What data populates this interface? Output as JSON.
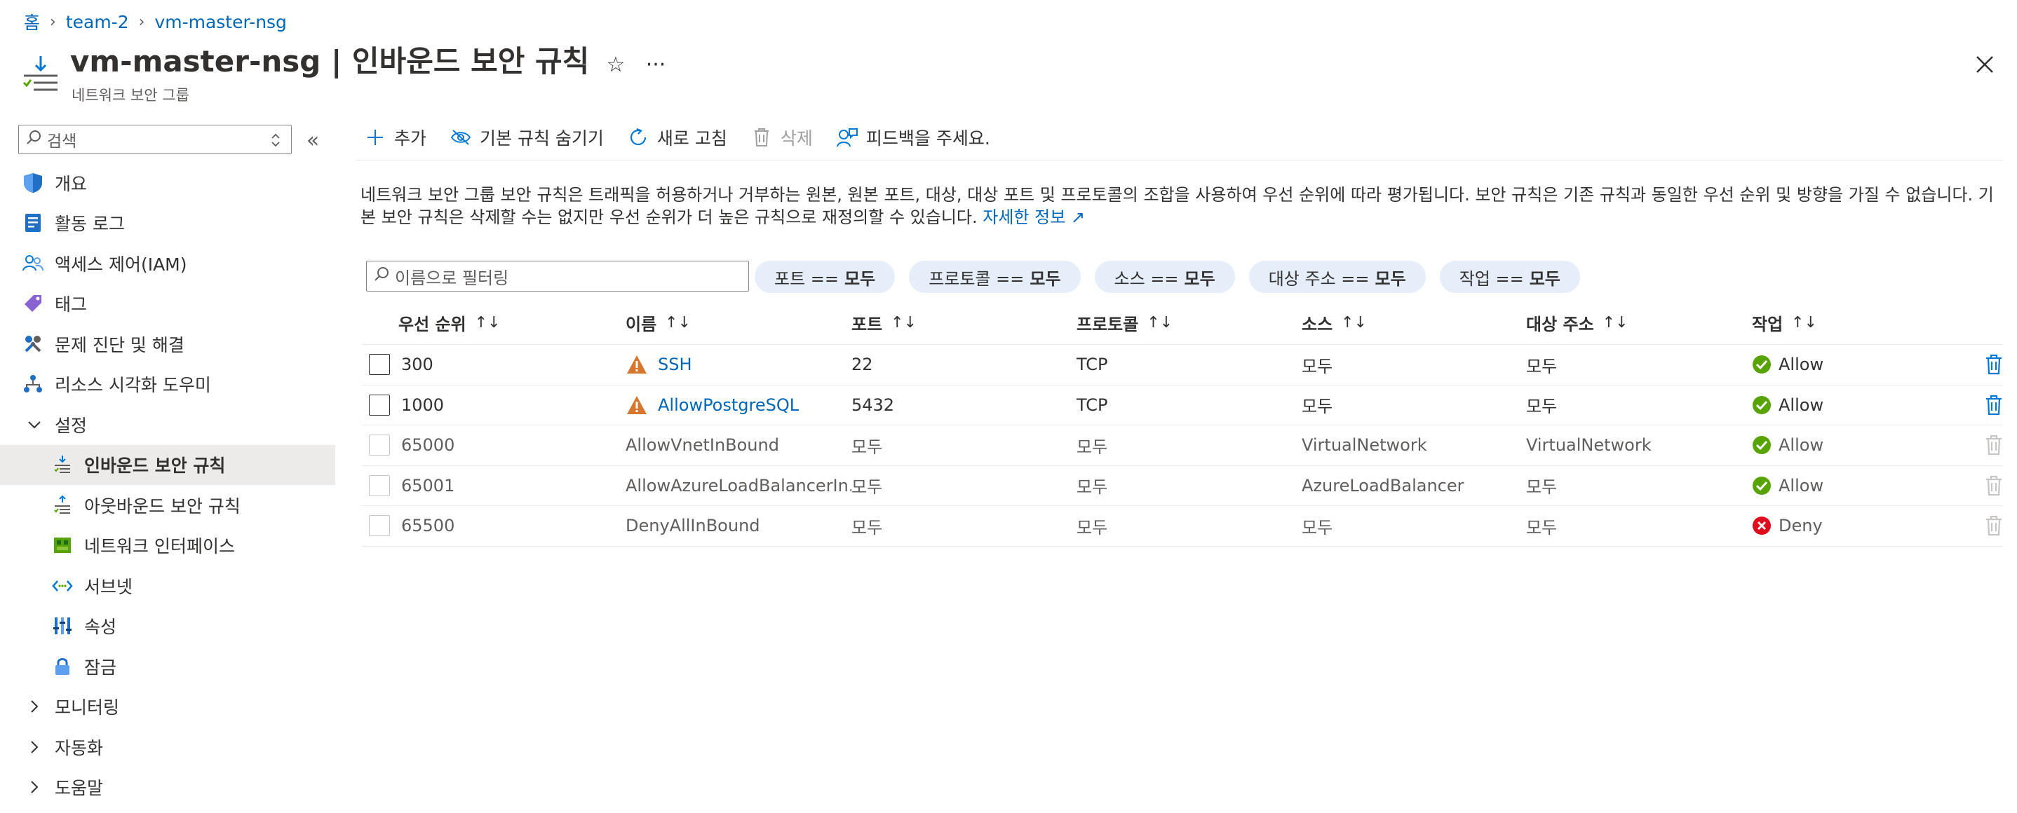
{
  "breadcrumb": [
    "홈",
    "team-2",
    "vm-master-nsg"
  ],
  "header": {
    "title": "vm-master-nsg | 인바운드 보안 규칙",
    "subtitle": "네트워크 보안 그룹"
  },
  "sidebar": {
    "search_placeholder": "검색",
    "items": [
      {
        "label": "개요",
        "icon": "shield-icon"
      },
      {
        "label": "활동 로그",
        "icon": "log-icon"
      },
      {
        "label": "액세스 제어(IAM)",
        "icon": "people-icon"
      },
      {
        "label": "태그",
        "icon": "tag-icon"
      },
      {
        "label": "문제 진단 및 해결",
        "icon": "wrench-icon"
      },
      {
        "label": "리소스 시각화 도우미",
        "icon": "hierarchy-icon"
      }
    ],
    "settings_group": "설정",
    "settings_items": [
      {
        "label": "인바운드 보안 규칙",
        "icon": "inbound-rules-icon"
      },
      {
        "label": "아웃바운드 보안 규칙",
        "icon": "outbound-rules-icon"
      },
      {
        "label": "네트워크 인터페이스",
        "icon": "nic-icon"
      },
      {
        "label": "서브넷",
        "icon": "subnet-icon"
      },
      {
        "label": "속성",
        "icon": "properties-icon"
      },
      {
        "label": "잠금",
        "icon": "lock-icon"
      }
    ],
    "groups": [
      "모니터링",
      "자동화",
      "도움말"
    ]
  },
  "toolbar": {
    "add": "추가",
    "hide_default": "기본 규칙 숨기기",
    "refresh": "새로 고침",
    "delete": "삭제",
    "feedback": "피드백을 주세요."
  },
  "description": {
    "text": "네트워크 보안 그룹 보안 규칙은 트래픽을 허용하거나 거부하는 원본, 원본 포트, 대상, 대상 포트 및 프로토콜의 조합을 사용하여 우선 순위에 따라 평가됩니다. 보안 규칙은 기존 규칙과 동일한 우선 순위 및 방향을 가질 수 없습니다. 기본 보안 규칙은 삭제할 수는 없지만 우선 순위가 더 높은 규칙으로 재정의할 수 있습니다.",
    "link": "자세한 정보"
  },
  "filter": {
    "placeholder": "이름으로 필터링",
    "pills": [
      {
        "key": "포트 ==",
        "value": "모두"
      },
      {
        "key": "프로토콜 ==",
        "value": "모두"
      },
      {
        "key": "소스 ==",
        "value": "모두"
      },
      {
        "key": "대상 주소 ==",
        "value": "모두"
      },
      {
        "key": "작업 ==",
        "value": "모두"
      }
    ]
  },
  "table": {
    "columns": [
      "우선 순위",
      "이름",
      "포트",
      "프로토콜",
      "소스",
      "대상 주소",
      "작업"
    ],
    "rows": [
      {
        "priority": "300",
        "name": "SSH",
        "port": "22",
        "protocol": "TCP",
        "source": "모두",
        "destination": "모두",
        "action": "Allow",
        "warning": true,
        "default": false
      },
      {
        "priority": "1000",
        "name": "AllowPostgreSQL",
        "port": "5432",
        "protocol": "TCP",
        "source": "모두",
        "destination": "모두",
        "action": "Allow",
        "warning": true,
        "default": false
      },
      {
        "priority": "65000",
        "name": "AllowVnetInBound",
        "port": "모두",
        "protocol": "모두",
        "source": "VirtualNetwork",
        "destination": "VirtualNetwork",
        "action": "Allow",
        "warning": false,
        "default": true
      },
      {
        "priority": "65001",
        "name": "AllowAzureLoadBalancerIn...",
        "port": "모두",
        "protocol": "모두",
        "source": "AzureLoadBalancer",
        "destination": "모두",
        "action": "Allow",
        "warning": false,
        "default": true
      },
      {
        "priority": "65500",
        "name": "DenyAllInBound",
        "port": "모두",
        "protocol": "모두",
        "source": "모두",
        "destination": "모두",
        "action": "Deny",
        "warning": false,
        "default": true
      }
    ]
  },
  "colors": {
    "link": "#0066b8",
    "allow": "#57a300",
    "deny": "#e00b1c",
    "warning": "#d67730",
    "pill_bg": "#e5eef9",
    "active_nav": "#edebe9"
  }
}
